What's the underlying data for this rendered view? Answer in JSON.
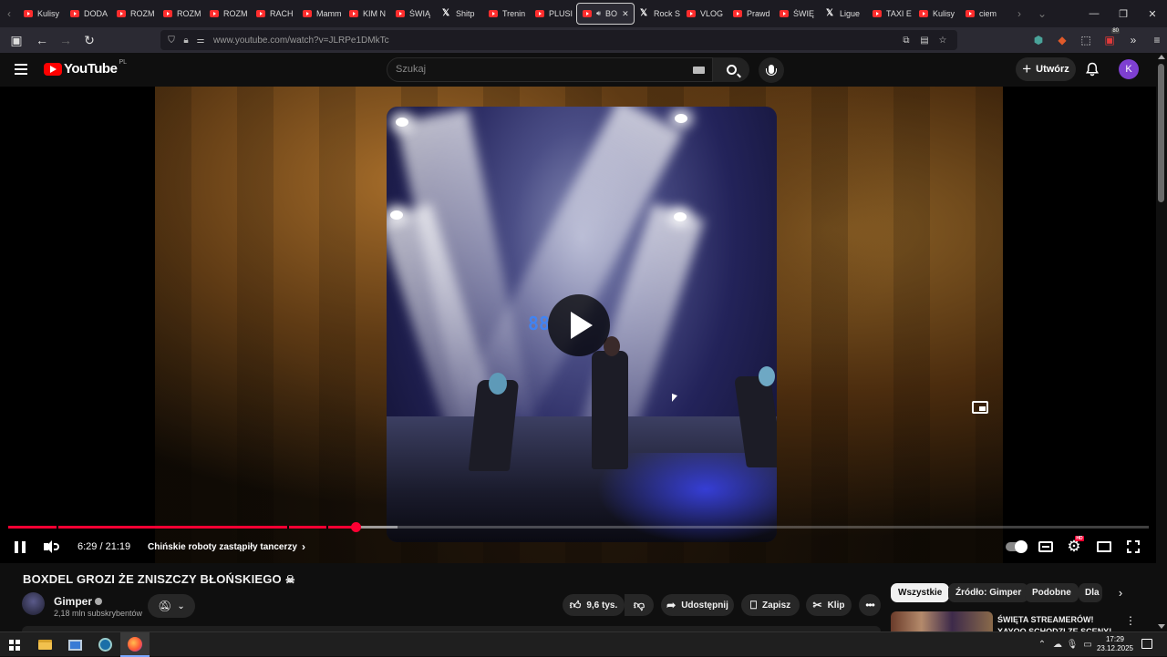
{
  "browser": {
    "tabs": [
      {
        "label": "Kulisy",
        "icon": "youtube-favicon-icon"
      },
      {
        "label": "DODA",
        "icon": "youtube-favicon-icon"
      },
      {
        "label": "ROZM",
        "icon": "youtube-favicon-icon"
      },
      {
        "label": "ROZM",
        "icon": "youtube-favicon-icon"
      },
      {
        "label": "ROZM",
        "icon": "youtube-favicon-icon"
      },
      {
        "label": "RACH",
        "icon": "youtube-favicon-icon"
      },
      {
        "label": "Mamm",
        "icon": "youtube-favicon-icon"
      },
      {
        "label": "KIM N",
        "icon": "youtube-favicon-icon"
      },
      {
        "label": "ŚWIĄ",
        "icon": "youtube-favicon-icon"
      },
      {
        "label": "Shitp",
        "icon": "x-favicon-icon"
      },
      {
        "label": "Trenin",
        "icon": "youtube-favicon-icon"
      },
      {
        "label": "PLUSI",
        "icon": "youtube-favicon-icon"
      },
      {
        "label": "BO",
        "icon": "youtube-favicon-icon",
        "active": true
      },
      {
        "label": "Rock S",
        "icon": "x-favicon-icon"
      },
      {
        "label": "VLOG",
        "icon": "youtube-favicon-icon"
      },
      {
        "label": "Prawd",
        "icon": "youtube-favicon-icon"
      },
      {
        "label": "ŚWIĘ",
        "icon": "youtube-favicon-icon"
      },
      {
        "label": "Ligue",
        "icon": "x-favicon-icon"
      },
      {
        "label": "TAXI E",
        "icon": "youtube-favicon-icon"
      },
      {
        "label": "Kulisy",
        "icon": "youtube-favicon-icon"
      },
      {
        "label": "ciem",
        "icon": "youtube-favicon-icon"
      }
    ],
    "url": "www.youtube.com/watch?v=JLRPe1DMkTc",
    "extension_badge": "80"
  },
  "header": {
    "logo_text": "YouTube",
    "logo_country": "PL",
    "search_placeholder": "Szukaj",
    "create_label": "Utwórz",
    "avatar_letter": "K"
  },
  "player": {
    "current_time": "6:29",
    "duration": "21:19",
    "time_display": "6:29 / 21:19",
    "chapter_title": "Chińskie roboty zastąpiły tancerzy",
    "played_fraction": 0.3042,
    "buffered_fraction": 0.341,
    "chapter_marks": [
      0.042,
      0.245,
      0.279
    ],
    "accent_color": "#ff0033"
  },
  "video": {
    "title": "BOXDEL GROZI ŻE ZNISZCZY BŁOŃSKIEGO",
    "title_emoji": "☠",
    "channel_name": "Gimper",
    "subscribers": "2,18 mln subskrybentów",
    "likes": "9,6 tys.",
    "share_label": "Udostępnij",
    "save_label": "Zapisz",
    "clip_label": "Klip"
  },
  "chips": {
    "items": [
      "Wszystkie",
      "Źródło: Gimper",
      "Podobne",
      "Dla"
    ]
  },
  "recommendation": {
    "title": "ŚWIĘTA STREAMERÓW! XAYOO SCHODZI ZE SCENY!"
  },
  "taskbar": {
    "time": "17:29",
    "date": "23.12.2025"
  }
}
